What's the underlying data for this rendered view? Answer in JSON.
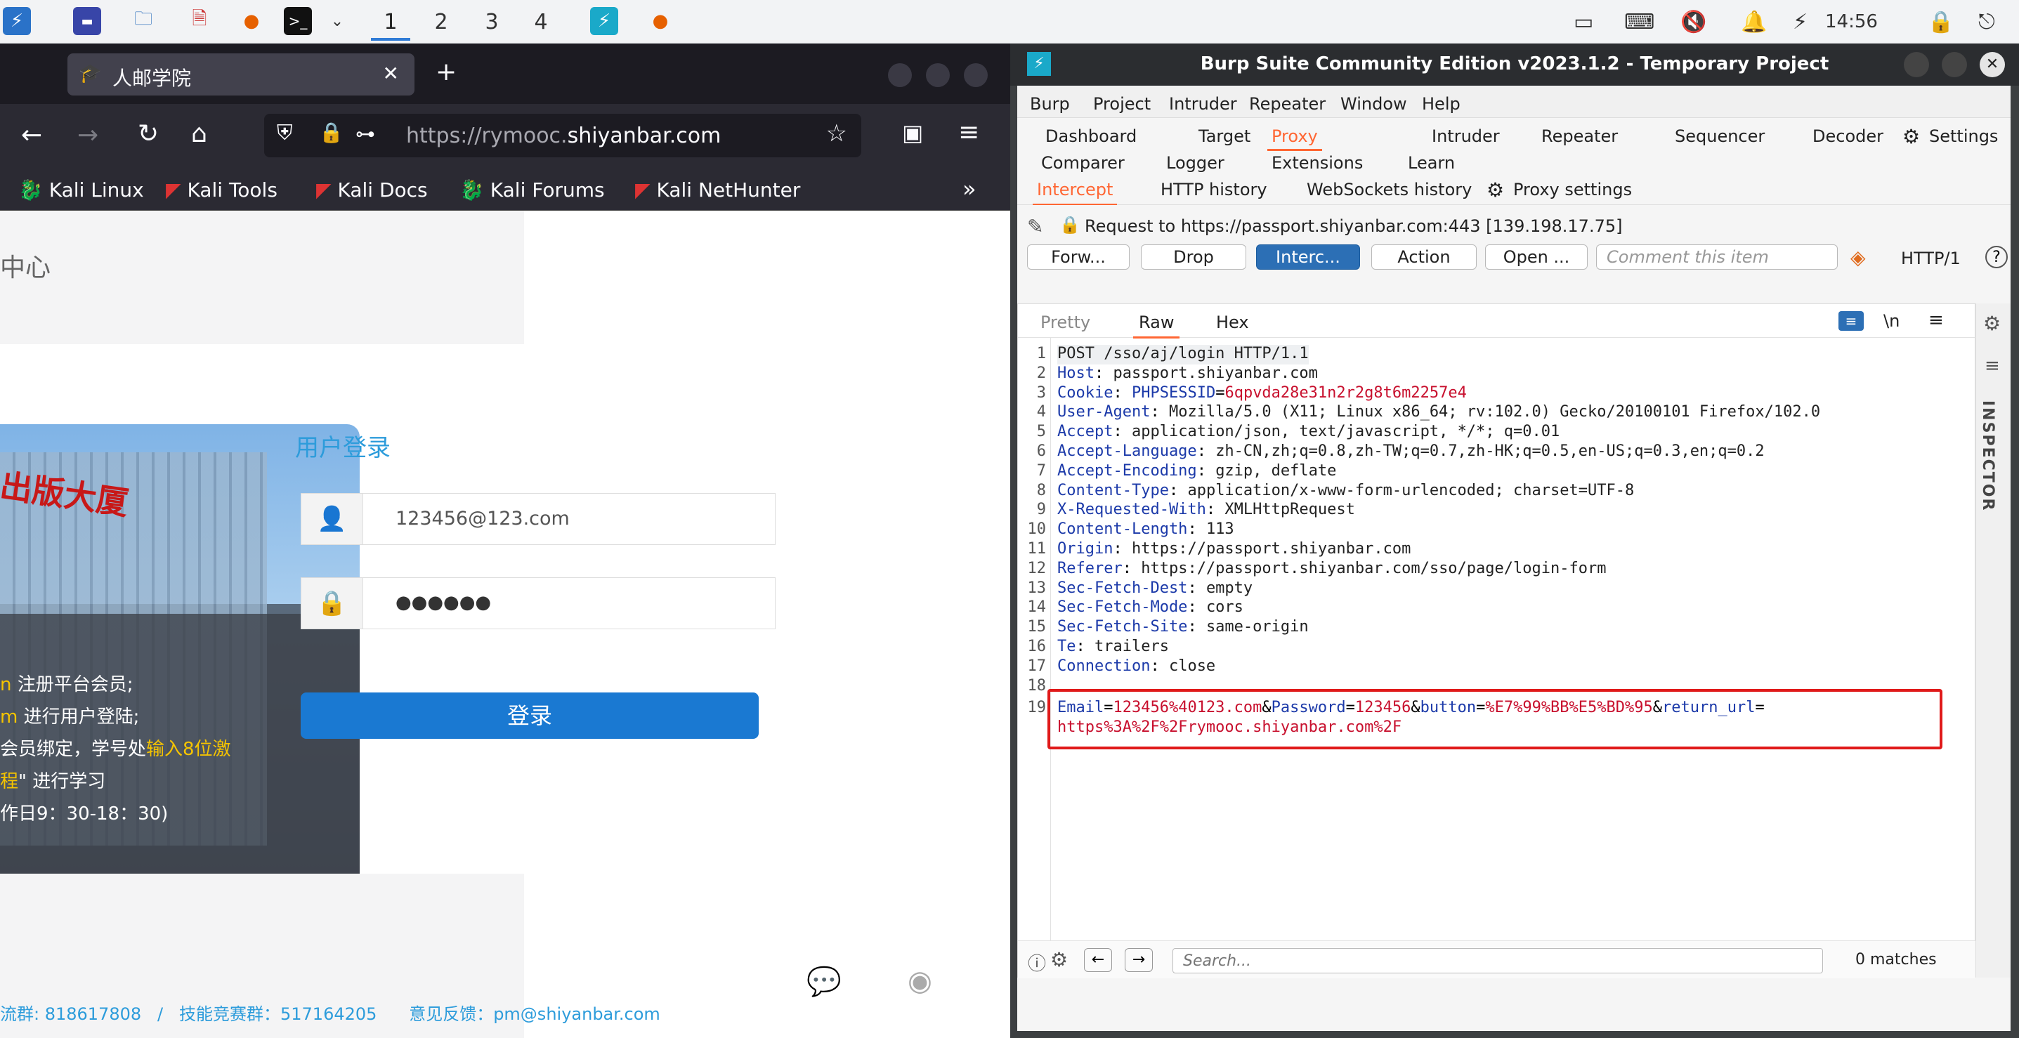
{
  "taskbar": {
    "workspaces": [
      "1",
      "2",
      "3",
      "4"
    ],
    "clock": "14:56"
  },
  "firefox": {
    "tab_title": "人邮学院",
    "url_prefix": "https://rymooc.",
    "url_domain": "shiyanbar.com",
    "bookmarks": [
      "Kali Linux",
      "Kali Tools",
      "Kali Docs",
      "Kali Forums",
      "Kali NetHunter"
    ],
    "page": {
      "header_fragment": "中心",
      "building_sign": "出版大厦",
      "login_title": "用户登录",
      "email_value": "123456@123.com",
      "password_value": "●●●●●●",
      "login_button": "登录",
      "info_lines": [
        {
          "hl": "n",
          "text": " 注册平台会员;"
        },
        {
          "hl": "m",
          "text": " 进行用户登陆;"
        },
        {
          "pre": "会员绑定，学号处",
          "hl": "输入8位激",
          "text": ""
        },
        {
          "hl": "程",
          "text": "\" 进行学习"
        },
        {
          "pre": "作日9：30-18：30)",
          "hl": "",
          "text": ""
        }
      ],
      "footer": "流群: 818617808   /   技能竞赛群：517164205      意见反馈：pm@shiyanbar.com"
    }
  },
  "burp": {
    "title": "Burp Suite Community Edition v2023.1.2 - Temporary Project",
    "menu": [
      "Burp",
      "Project",
      "Intruder",
      "Repeater",
      "Window",
      "Help"
    ],
    "tabs_row1": [
      "Dashboard",
      "Target",
      "Proxy",
      "Intruder",
      "Repeater",
      "Sequencer",
      "Decoder",
      "Settings"
    ],
    "tabs_row2": [
      "Comparer",
      "Logger",
      "Extensions",
      "Learn"
    ],
    "subtabs": [
      "Intercept",
      "HTTP history",
      "WebSockets history",
      "Proxy settings"
    ],
    "request_info": "Request to https://passport.shiyanbar.com:443  [139.198.17.75]",
    "buttons": [
      "Forw...",
      "Drop",
      "Interc...",
      "Action",
      "Open ..."
    ],
    "comment_placeholder": "Comment this item",
    "http_version": "HTTP/1",
    "view_tabs": [
      "Pretty",
      "Raw",
      "Hex"
    ],
    "newline_toggle": "\\n",
    "inspector_label": "INSPECTOR",
    "request_lines": [
      {
        "n": "1",
        "k": "",
        "v": "POST /sso/aj/login HTTP/1.1"
      },
      {
        "n": "2",
        "k": "Host",
        "v": "passport.shiyanbar.com"
      },
      {
        "n": "3",
        "k": "Cookie",
        "v": "",
        "ck": "PHPSESSID",
        "cv": "6qpvda28e31n2r2g8t6m2257e4"
      },
      {
        "n": "4",
        "k": "User-Agent",
        "v": "Mozilla/5.0 (X11; Linux x86_64; rv:102.0) Gecko/20100101 Firefox/102.0"
      },
      {
        "n": "5",
        "k": "Accept",
        "v": "application/json, text/javascript, */*; q=0.01"
      },
      {
        "n": "6",
        "k": "Accept-Language",
        "v": "zh-CN,zh;q=0.8,zh-TW;q=0.7,zh-HK;q=0.5,en-US;q=0.3,en;q=0.2"
      },
      {
        "n": "7",
        "k": "Accept-Encoding",
        "v": "gzip, deflate"
      },
      {
        "n": "8",
        "k": "Content-Type",
        "v": "application/x-www-form-urlencoded; charset=UTF-8"
      },
      {
        "n": "9",
        "k": "X-Requested-With",
        "v": "XMLHttpRequest"
      },
      {
        "n": "10",
        "k": "Content-Length",
        "v": "113"
      },
      {
        "n": "11",
        "k": "Origin",
        "v": "https://passport.shiyanbar.com"
      },
      {
        "n": "12",
        "k": "Referer",
        "v": "https://passport.shiyanbar.com/sso/page/login-form"
      },
      {
        "n": "13",
        "k": "Sec-Fetch-Dest",
        "v": "empty"
      },
      {
        "n": "14",
        "k": "Sec-Fetch-Mode",
        "v": "cors"
      },
      {
        "n": "15",
        "k": "Sec-Fetch-Site",
        "v": "same-origin"
      },
      {
        "n": "16",
        "k": "Te",
        "v": "trailers"
      },
      {
        "n": "17",
        "k": "Connection",
        "v": "close"
      },
      {
        "n": "18",
        "k": "",
        "v": ""
      }
    ],
    "body_line_number": "19",
    "body_params": [
      {
        "k": "Email",
        "v": "123456%40123.com"
      },
      {
        "k": "Password",
        "v": "123456"
      },
      {
        "k": "button",
        "v": "%E7%99%BB%E5%BD%95"
      },
      {
        "k": "return_url",
        "v": ""
      }
    ],
    "body_continuation": "https%3A%2F%2Frymooc.shiyanbar.com%2F",
    "search_placeholder": "Search...",
    "matches": "0 matches",
    "colors": {
      "proxy_accent": "#ff6633",
      "highlight_box": "#e01a1a",
      "intercept_btn": "#2c6fb5"
    }
  }
}
